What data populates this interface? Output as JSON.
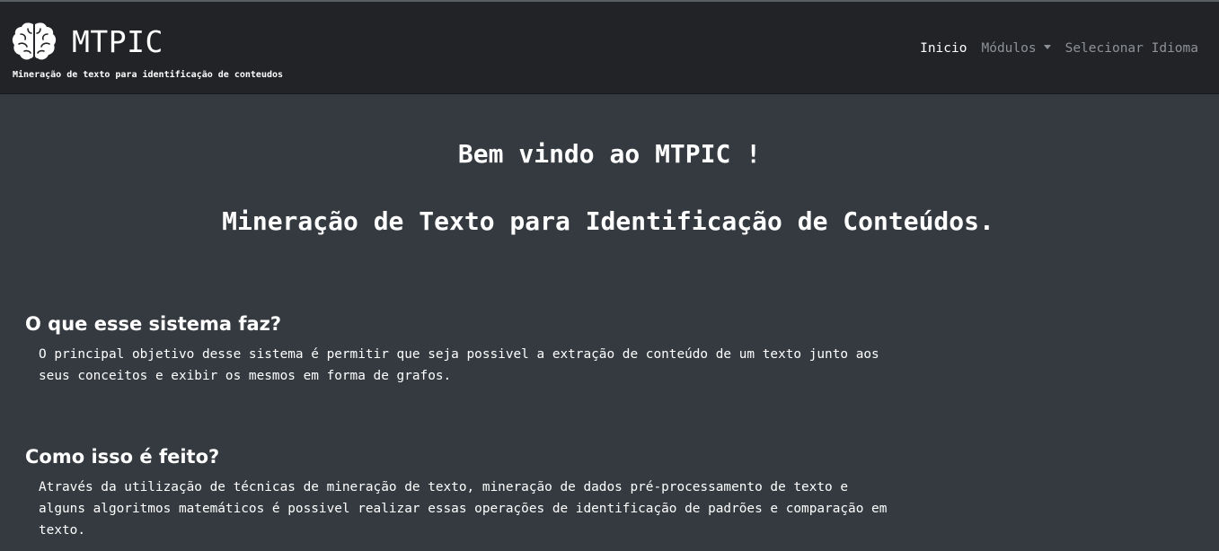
{
  "brand": {
    "name": "MTPIC",
    "subtitle": "Mineração de texto para identificação de conteudos",
    "logo_icon": "brain-icon"
  },
  "nav": {
    "items": [
      {
        "label": "Inicio",
        "active": true
      },
      {
        "label": "Módulos",
        "dropdown": true
      },
      {
        "label": "Selecionar Idioma"
      }
    ]
  },
  "main": {
    "welcome": "Bem vindo ao MTPIC !",
    "subtitle": "Mineração de Texto para Identificação de Conteúdos.",
    "sections": [
      {
        "title": "O que esse sistema faz?",
        "text": "O principal objetivo desse sistema é permitir que seja possivel a extração de conteúdo de um texto junto aos seus conceitos e exibir os mesmos em forma de grafos."
      },
      {
        "title": "Como isso é feito?",
        "text": "Através da utilização de técnicas de mineração de texto, mineração de dados pré-processamento de texto e alguns algoritmos matemáticos é possivel realizar essas operações de identificação de padrões e comparação em texto."
      }
    ]
  },
  "colors": {
    "navbar_bg": "#212327",
    "page_bg": "#343a40",
    "text": "#ffffff",
    "muted_link": "#8e9297"
  }
}
